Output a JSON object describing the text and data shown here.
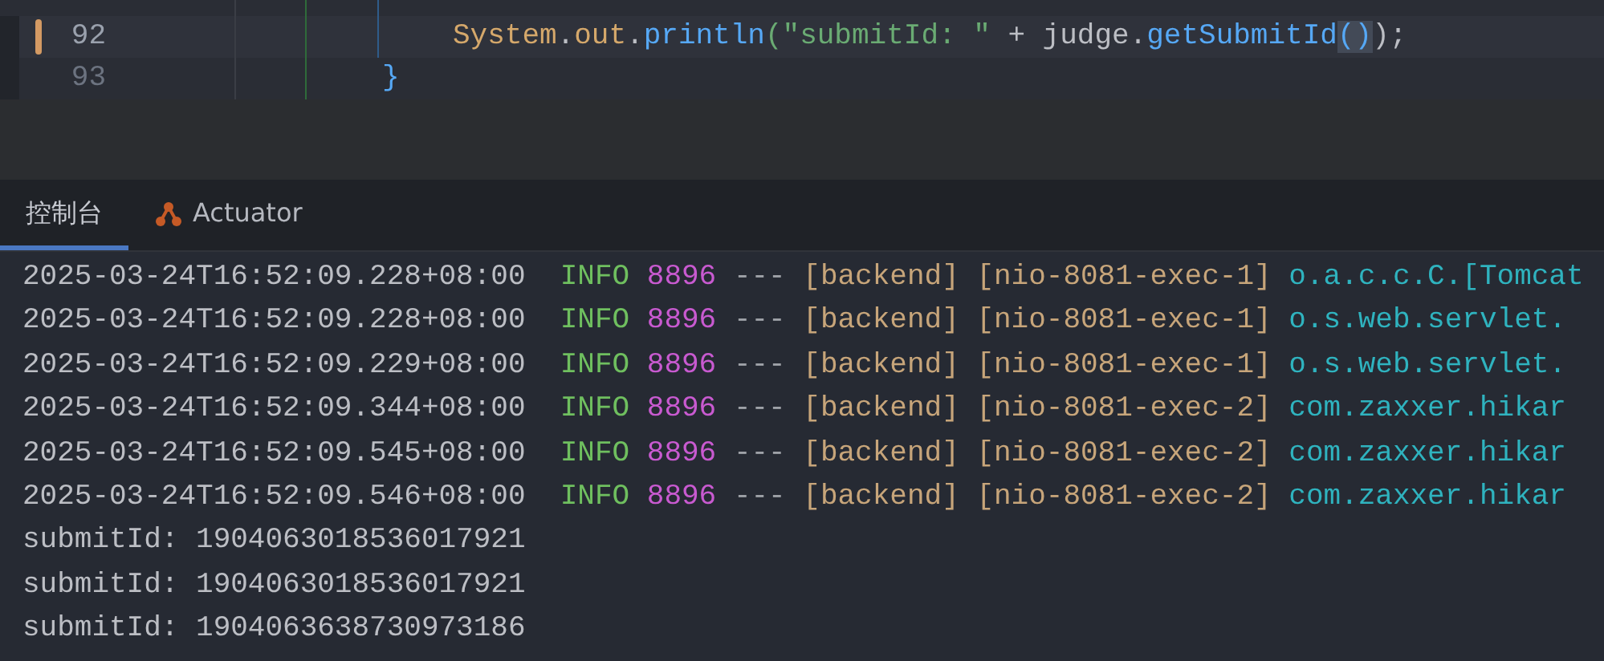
{
  "editor": {
    "lines": [
      {
        "number": "92",
        "current": true,
        "changed": true,
        "tokens": [
          {
            "text": "System",
            "kind": "field"
          },
          {
            "text": ".",
            "kind": "plain"
          },
          {
            "text": "out",
            "kind": "field"
          },
          {
            "text": ".",
            "kind": "plain"
          },
          {
            "text": "println",
            "kind": "method"
          },
          {
            "text": "(",
            "kind": "paren"
          },
          {
            "text": "\"submitId: \"",
            "kind": "string"
          },
          {
            "text": " + judge.",
            "kind": "plain"
          },
          {
            "text": "getSubmitId",
            "kind": "method"
          },
          {
            "text": "()",
            "kind": "match"
          },
          {
            "text": ");",
            "kind": "plain"
          }
        ]
      },
      {
        "number": "93",
        "current": false,
        "changed": false,
        "tokens": [
          {
            "text": "}",
            "kind": "method"
          }
        ]
      }
    ]
  },
  "tool_window": {
    "tabs": [
      {
        "label": "控制台",
        "selected": true,
        "icon": false
      },
      {
        "label": "Actuator",
        "selected": false,
        "icon": true
      }
    ]
  },
  "console": {
    "lines": [
      {
        "kind": "log",
        "timestamp": "2025-03-24T16:52:09.228+08:00",
        "level": "INFO",
        "pid": "8896",
        "separator": "---",
        "app": "[backend]",
        "thread": "[nio-8081-exec-1]",
        "logger": "o.a.c.c.C.[Tomcat"
      },
      {
        "kind": "log",
        "timestamp": "2025-03-24T16:52:09.228+08:00",
        "level": "INFO",
        "pid": "8896",
        "separator": "---",
        "app": "[backend]",
        "thread": "[nio-8081-exec-1]",
        "logger": "o.s.web.servlet."
      },
      {
        "kind": "log",
        "timestamp": "2025-03-24T16:52:09.229+08:00",
        "level": "INFO",
        "pid": "8896",
        "separator": "---",
        "app": "[backend]",
        "thread": "[nio-8081-exec-1]",
        "logger": "o.s.web.servlet."
      },
      {
        "kind": "log",
        "timestamp": "2025-03-24T16:52:09.344+08:00",
        "level": "INFO",
        "pid": "8896",
        "separator": "---",
        "app": "[backend]",
        "thread": "[nio-8081-exec-2]",
        "logger": "com.zaxxer.hikar"
      },
      {
        "kind": "log",
        "timestamp": "2025-03-24T16:52:09.545+08:00",
        "level": "INFO",
        "pid": "8896",
        "separator": "---",
        "app": "[backend]",
        "thread": "[nio-8081-exec-2]",
        "logger": "com.zaxxer.hikar"
      },
      {
        "kind": "log",
        "timestamp": "2025-03-24T16:52:09.546+08:00",
        "level": "INFO",
        "pid": "8896",
        "separator": "---",
        "app": "[backend]",
        "thread": "[nio-8081-exec-2]",
        "logger": "com.zaxxer.hikar"
      },
      {
        "kind": "plain",
        "text": "submitId: 1904063018536017921"
      },
      {
        "kind": "plain",
        "text": "submitId: 1904063018536017921"
      },
      {
        "kind": "plain",
        "text": "submitId: 1904063638730973186"
      }
    ]
  }
}
